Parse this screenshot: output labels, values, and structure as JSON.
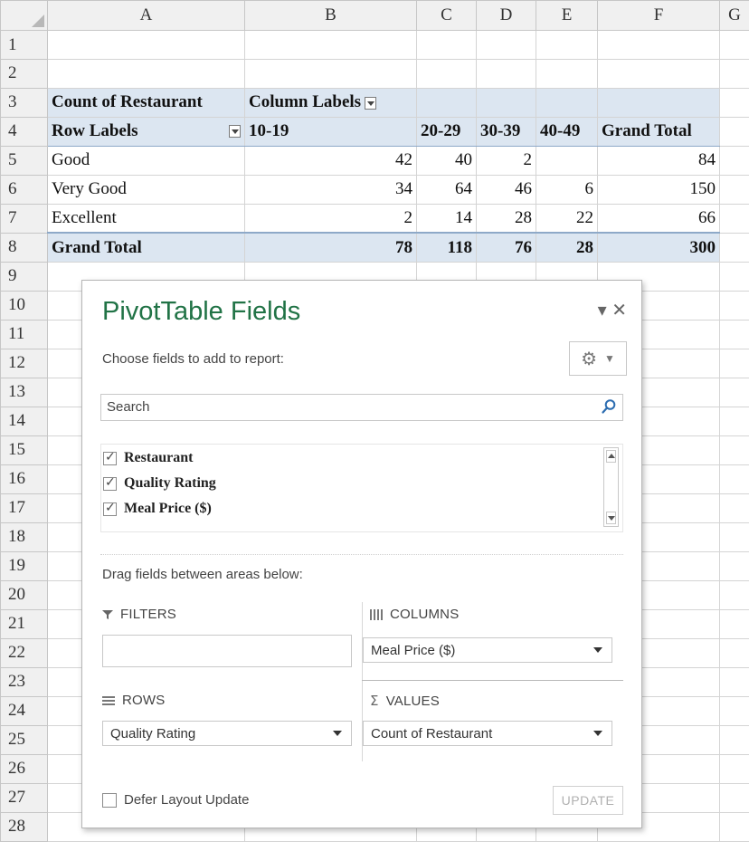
{
  "sheet": {
    "columns": [
      "A",
      "B",
      "C",
      "D",
      "E",
      "F",
      "G"
    ],
    "rows": [
      "1",
      "2",
      "3",
      "4",
      "5",
      "6",
      "7",
      "8",
      "9",
      "10",
      "11",
      "12",
      "13",
      "14",
      "15",
      "16",
      "17",
      "18",
      "19",
      "20",
      "21",
      "22",
      "23",
      "24",
      "25",
      "26",
      "27",
      "28"
    ]
  },
  "pivot": {
    "count_label": "Count of Restaurant",
    "column_labels": "Column Labels",
    "row_labels": "Row Labels",
    "col_headers": [
      "10-19",
      "20-29",
      "30-39",
      "40-49",
      "Grand Total"
    ],
    "data_rows": [
      {
        "label": "Good",
        "values": [
          "42",
          "40",
          "2",
          "",
          "84"
        ]
      },
      {
        "label": "Very Good",
        "values": [
          "34",
          "64",
          "46",
          "6",
          "150"
        ]
      },
      {
        "label": "Excellent",
        "values": [
          "2",
          "14",
          "28",
          "22",
          "66"
        ]
      }
    ],
    "total_row": {
      "label": "Grand Total",
      "values": [
        "78",
        "118",
        "76",
        "28",
        "300"
      ]
    }
  },
  "pane": {
    "title": "PivotTable Fields",
    "controls": "▾ ✕",
    "choose_label": "Choose fields to add to report:",
    "search_placeholder": "Search",
    "fields": [
      {
        "label": "Restaurant",
        "checked": true
      },
      {
        "label": "Quality Rating",
        "checked": true
      },
      {
        "label": "Meal Price ($)",
        "checked": true
      }
    ],
    "drag_label": "Drag fields between areas below:",
    "areas": {
      "filters": {
        "label": "FILTERS"
      },
      "columns": {
        "label": "COLUMNS",
        "item": "Meal Price ($)"
      },
      "rows": {
        "label": "ROWS",
        "item": "Quality Rating"
      },
      "values": {
        "label": "VALUES",
        "item": "Count of Restaurant"
      }
    },
    "defer_label": "Defer Layout Update",
    "update_label": "UPDATE"
  },
  "colors": {
    "accent_green": "#217346",
    "pivot_header": "#dce6f1"
  }
}
